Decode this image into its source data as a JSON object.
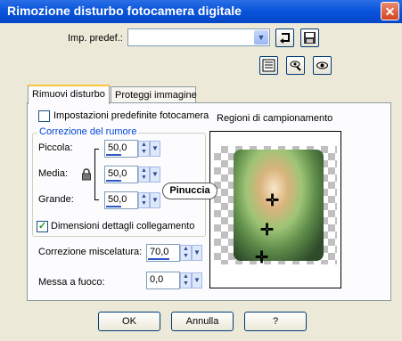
{
  "window": {
    "title": "Rimozione disturbo fotocamera digitale",
    "close_glyph": "✕"
  },
  "preset": {
    "label": "Imp. predef.:",
    "value": "",
    "icons": [
      "reset-icon",
      "save-icon"
    ]
  },
  "toolbar": {
    "icons": [
      "randomize-icon",
      "hand-preview-icon",
      "eye-icon"
    ]
  },
  "tabs": [
    {
      "label": "Rimuovi disturbo",
      "active": true
    },
    {
      "label": "Proteggi immagine",
      "active": false
    }
  ],
  "main": {
    "default_settings_label": "Impostazioni predefinite fotocamera",
    "default_settings_checked": false,
    "noise_group_title": "Correzione del rumore",
    "fields": [
      {
        "label": "Piccola:",
        "value": "50,0",
        "bar_fraction": 0.5
      },
      {
        "label": "Media:",
        "value": "50,0",
        "bar_fraction": 0.5
      },
      {
        "label": "Grande:",
        "value": "50,0",
        "bar_fraction": 0.5
      }
    ],
    "link_checkbox_label": "Dimensioni dettagli collegamento",
    "link_checkbox_checked": true,
    "blend": {
      "label": "Correzione miscelatura:",
      "value": "70,0",
      "bar_fraction": 0.7
    },
    "sharpen": {
      "label": "Messa a fuoco:",
      "value": "0,0",
      "bar_fraction": 0.0
    },
    "sampling_title": "Regioni di campionamento",
    "watermark": "Pinuccia"
  },
  "buttons": {
    "ok": "OK",
    "cancel": "Annulla",
    "help": "?"
  }
}
